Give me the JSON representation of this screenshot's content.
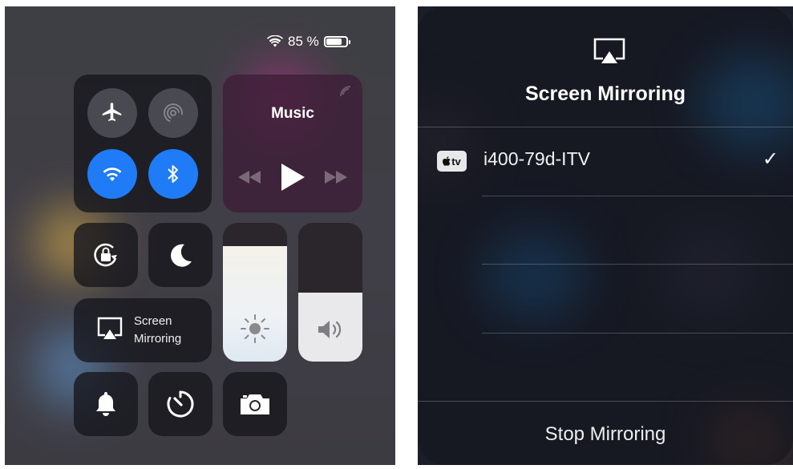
{
  "control_center": {
    "status_bar": {
      "battery_text": "85 %",
      "battery_level": 0.85,
      "wifi_icon": "wifi-icon"
    },
    "connectivity": [
      {
        "name": "airplane-mode",
        "icon": "airplane-icon",
        "active": false
      },
      {
        "name": "airdrop",
        "icon": "airdrop-icon",
        "active": false
      },
      {
        "name": "wifi",
        "icon": "wifi-icon",
        "active": true
      },
      {
        "name": "bluetooth",
        "icon": "bluetooth-icon",
        "active": true
      }
    ],
    "music": {
      "title": "Music",
      "airplay_icon": "airplay-audio-icon"
    },
    "orientation_lock_icon": "orientation-lock-icon",
    "do_not_disturb_icon": "moon-icon",
    "screen_mirroring": {
      "line1": "Screen",
      "line2": "Mirroring",
      "icon": "airplay-screen-icon"
    },
    "brightness": {
      "level": 0.83,
      "icon": "sun-icon"
    },
    "volume": {
      "level": 0.5,
      "icon": "speaker-icon"
    },
    "bottom_row": [
      "bell-icon",
      "timer-icon",
      "camera-icon"
    ],
    "accent_color": "#1f7bf6"
  },
  "mirroring_sheet": {
    "header_icon": "airplay-screen-icon",
    "title": "Screen Mirroring",
    "devices": [
      {
        "badge": "tv",
        "name": "i400-79d-ITV",
        "selected": true
      }
    ],
    "stop_label": "Stop Mirroring",
    "checkmark": "✓"
  }
}
